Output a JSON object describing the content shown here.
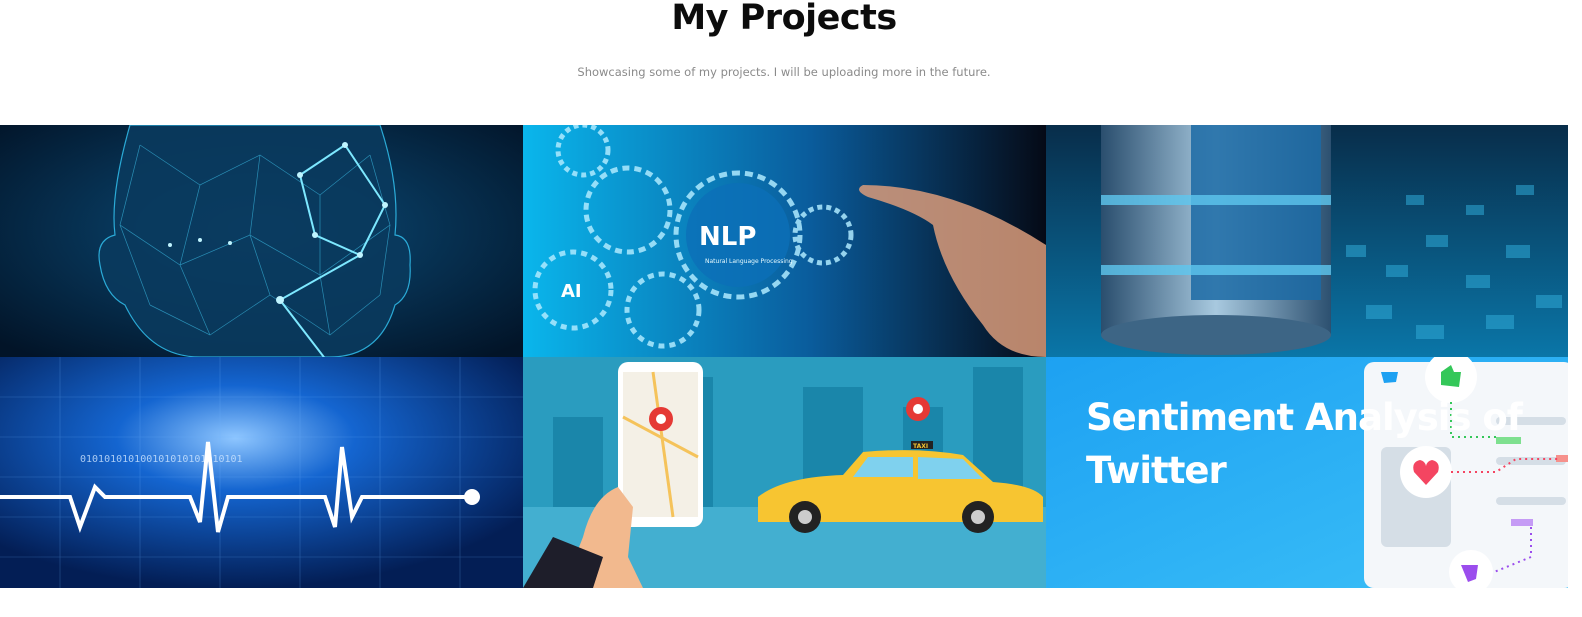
{
  "header": {
    "title": "My Projects",
    "subtitle": "Showcasing some of my projects. I will be uploading more in the future."
  },
  "projects": [
    {
      "icon": "face-recognition-image"
    },
    {
      "icon": "nlp-gears-image",
      "label": "NLP",
      "sublabel": "Natural Language Processing",
      "ai_label": "AI"
    },
    {
      "icon": "database-cylinder-image"
    },
    {
      "icon": "heartbeat-ecg-image",
      "binary": "010101010100101010101010101"
    },
    {
      "icon": "taxi-map-app-image",
      "taxi_sign": "TAXI"
    },
    {
      "icon": "twitter-sentiment-image",
      "title": "Sentiment Analysis of Twitter"
    }
  ],
  "colors": {
    "accent_blue": "#1da1f2",
    "taxi_yellow": "#f7c531",
    "twitter_bg": "#27a9ee"
  }
}
